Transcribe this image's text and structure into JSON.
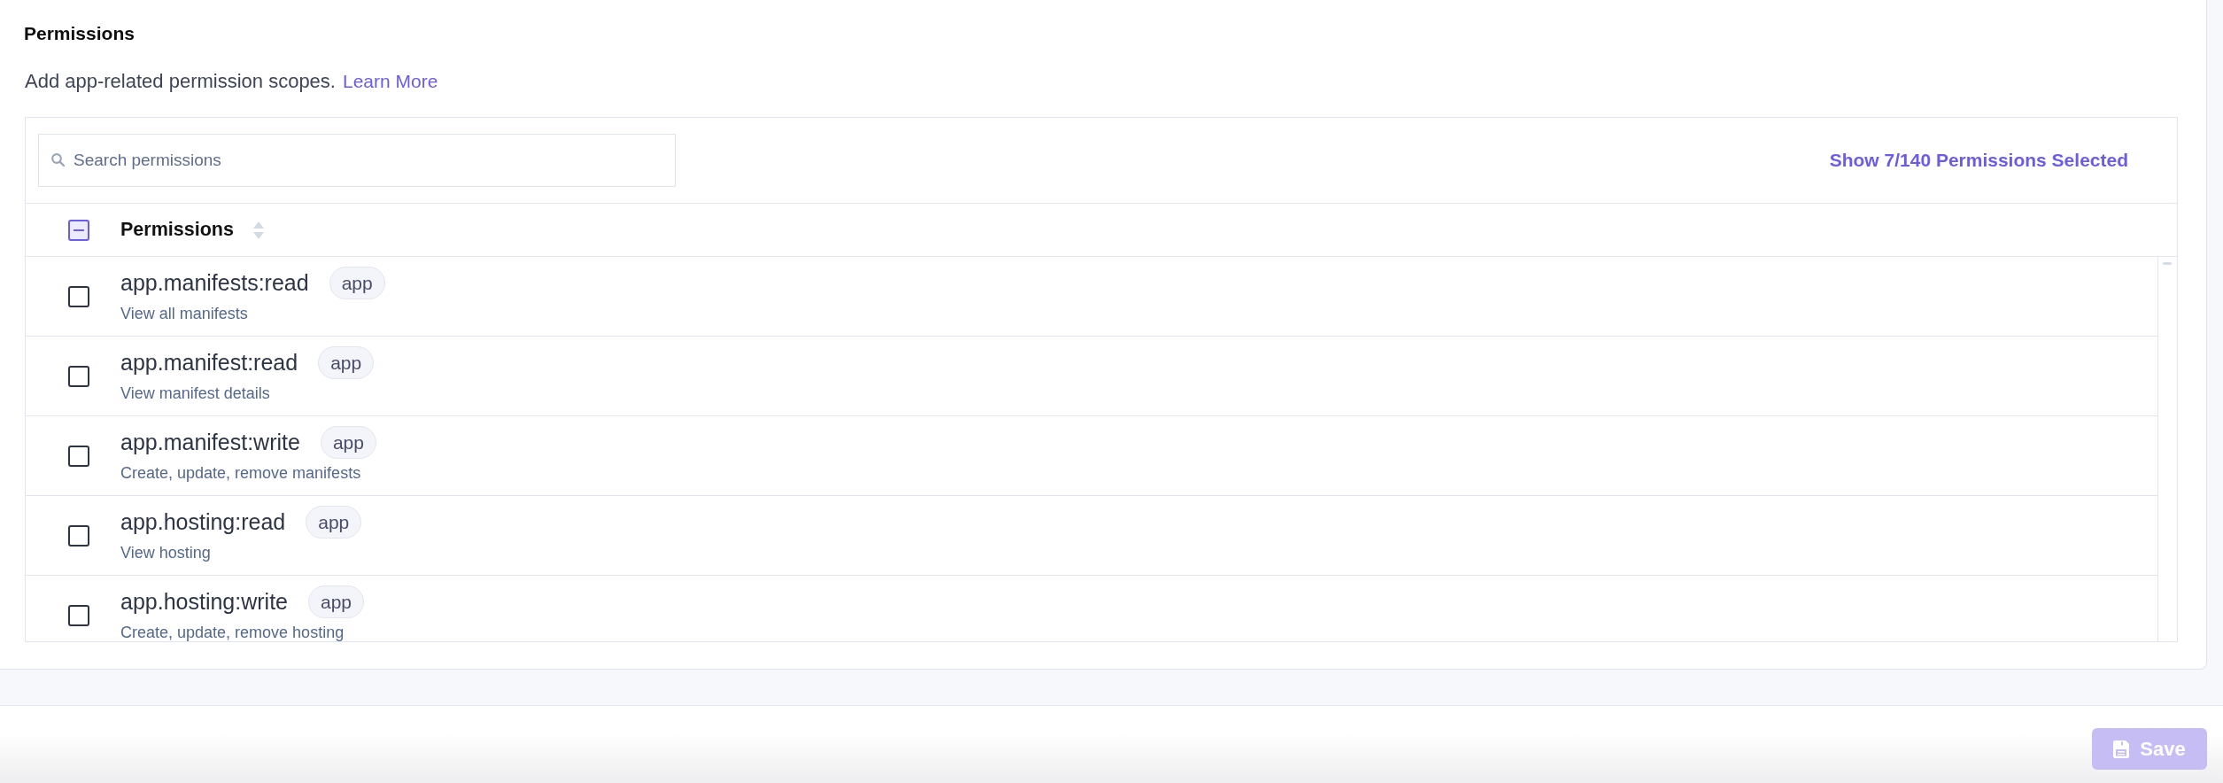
{
  "section": {
    "title": "Permissions",
    "description": "Add app-related permission scopes.",
    "link": "Learn More"
  },
  "toolbar": {
    "search": {
      "placeholder": "Search permissions"
    },
    "selected_link": "Show 7/140 Permissions Selected"
  },
  "table": {
    "header": {
      "label": "Permissions",
      "indeterminate": true
    },
    "rows": [
      {
        "name": "app.manifests:read",
        "tag": "app",
        "description": "View all manifests",
        "checked": false
      },
      {
        "name": "app.manifest:read",
        "tag": "app",
        "description": "View manifest details",
        "checked": false
      },
      {
        "name": "app.manifest:write",
        "tag": "app",
        "description": "Create, update, remove manifests",
        "checked": false
      },
      {
        "name": "app.hosting:read",
        "tag": "app",
        "description": "View hosting",
        "checked": false
      },
      {
        "name": "app.hosting:write",
        "tag": "app",
        "description": "Create, update, remove hosting",
        "checked": false
      }
    ]
  },
  "footer": {
    "save_button": {
      "label": "Save",
      "disabled": true
    }
  }
}
